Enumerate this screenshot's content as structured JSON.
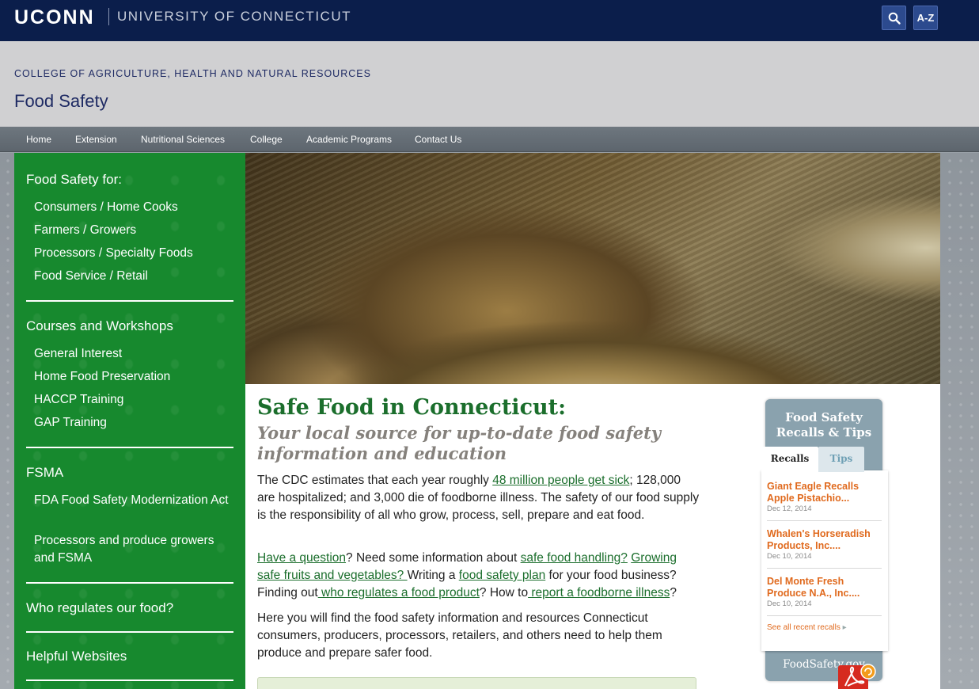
{
  "header": {
    "logo": "UCONN",
    "university": "UNIVERSITY OF CONNECTICUT",
    "search_icon": "search-icon",
    "az_label": "A-Z"
  },
  "college": {
    "name": "COLLEGE OF AGRICULTURE, HEALTH AND NATURAL RESOURCES",
    "site_title": "Food Safety"
  },
  "nav": {
    "items": [
      "Home",
      "Extension",
      "Nutritional Sciences",
      "College",
      "Academic Programs",
      "Contact Us"
    ]
  },
  "sidebar": {
    "section1_heading": "Food Safety for:",
    "section1_links": [
      "Consumers / Home Cooks",
      "Farmers / Growers",
      "Processors / Specialty Foods",
      "Food Service / Retail"
    ],
    "section2_heading": "Courses and Workshops",
    "section2_links": [
      "General Interest",
      "Home Food Preservation",
      "HACCP Training",
      "GAP Training"
    ],
    "section3_heading": "FSMA",
    "section3_links": [
      "FDA Food Safety Modernization Act",
      "Processors and produce growers and FSMA"
    ],
    "section4_heading": "Who regulates our food?",
    "section5_heading": "Helpful Websites"
  },
  "main": {
    "title": "Safe Food in Connecticut:",
    "subtitle": "Your local source for up-to-date food safety information and education",
    "p1_pre": "The CDC estimates that each year roughly ",
    "p1_link": "48 million people get sick",
    "p1_post": "; 128,000 are hospitalized; and 3,000 die of foodborne illness. The safety of our food supply is the responsibility of all who grow, process, sell, prepare and eat food.",
    "p2_link1": "Have a question",
    "p2_t1": "? Need some information about ",
    "p2_link2": "safe food handling?",
    "p2_t2": " ",
    "p2_link3": "Growing safe fruits and vegetables? ",
    "p2_t3": "Writing a ",
    "p2_link4": "food safety plan",
    "p2_t4": " for your food business? Finding out",
    "p2_link5": " who regulates a food product",
    "p2_t5": "? How to",
    "p2_link6": " report a foodborne illness",
    "p2_t6": "?",
    "p3": "Here you will find the food safety information and resources Connecticut consumers, producers, processors, retailers, and others need to help them produce and prepare safer food."
  },
  "widget": {
    "title_line1": "Food Safety",
    "title_line2": "Recalls & Tips",
    "tab_recalls": "Recalls",
    "tab_tips": "Tips",
    "recalls": [
      {
        "title": "Giant Eagle Recalls Apple Pistachio...",
        "date": "Dec 12, 2014"
      },
      {
        "title": "Whalen's Horseradish Products, Inc....",
        "date": "Dec 10, 2014"
      },
      {
        "title": "Del Monte Fresh Produce N.A., Inc....",
        "date": "Dec 10, 2014"
      }
    ],
    "see_all": "See all recent recalls",
    "footer": "FoodSafety.gov"
  },
  "colors": {
    "uconn_navy": "#0b1e4b",
    "sidebar_green": "#17892e",
    "title_green": "#1b6e2c",
    "recall_orange": "#e06a1e"
  }
}
